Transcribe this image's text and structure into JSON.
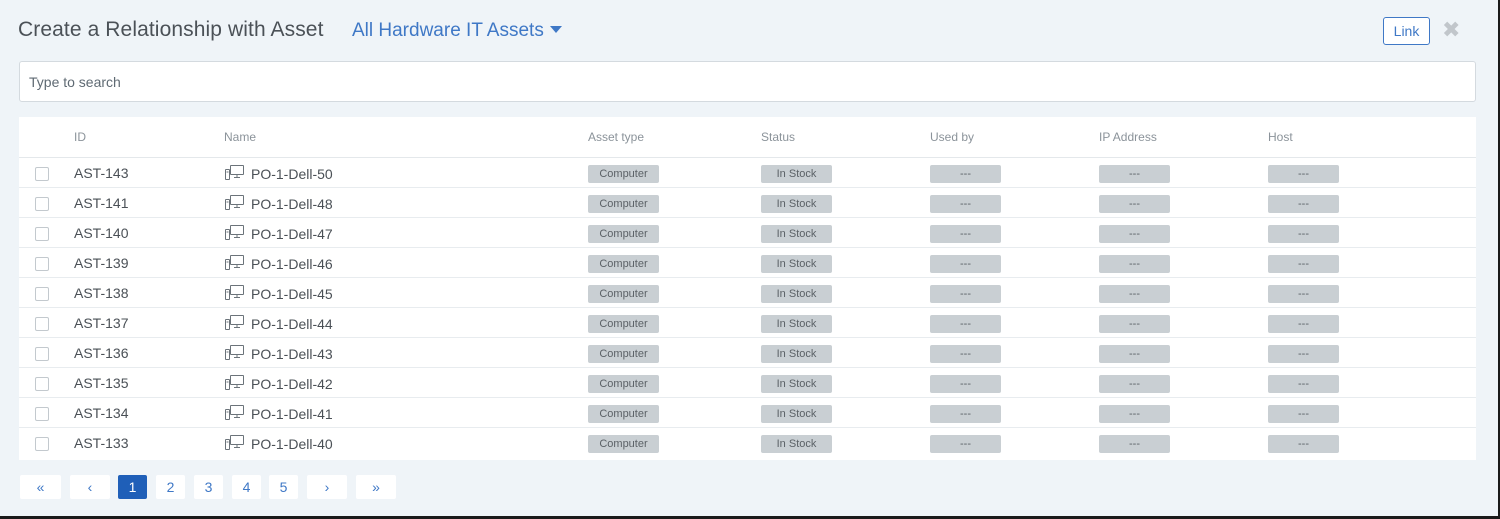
{
  "header": {
    "title": "Create a Relationship with Asset",
    "filter_label": "All Hardware IT Assets",
    "link_label": "Link",
    "close_glyph": "✖"
  },
  "search": {
    "placeholder": "Type to search"
  },
  "table": {
    "columns": [
      "ID",
      "Name",
      "Asset type",
      "Status",
      "Used by",
      "IP Address",
      "Host"
    ],
    "rows": [
      {
        "id": "AST-143",
        "name": "PO-1-Dell-50",
        "asset_type": "Computer",
        "status": "In Stock",
        "used_by": "---",
        "ip_address": "---",
        "host": "---"
      },
      {
        "id": "AST-141",
        "name": "PO-1-Dell-48",
        "asset_type": "Computer",
        "status": "In Stock",
        "used_by": "---",
        "ip_address": "---",
        "host": "---"
      },
      {
        "id": "AST-140",
        "name": "PO-1-Dell-47",
        "asset_type": "Computer",
        "status": "In Stock",
        "used_by": "---",
        "ip_address": "---",
        "host": "---"
      },
      {
        "id": "AST-139",
        "name": "PO-1-Dell-46",
        "asset_type": "Computer",
        "status": "In Stock",
        "used_by": "---",
        "ip_address": "---",
        "host": "---"
      },
      {
        "id": "AST-138",
        "name": "PO-1-Dell-45",
        "asset_type": "Computer",
        "status": "In Stock",
        "used_by": "---",
        "ip_address": "---",
        "host": "---"
      },
      {
        "id": "AST-137",
        "name": "PO-1-Dell-44",
        "asset_type": "Computer",
        "status": "In Stock",
        "used_by": "---",
        "ip_address": "---",
        "host": "---"
      },
      {
        "id": "AST-136",
        "name": "PO-1-Dell-43",
        "asset_type": "Computer",
        "status": "In Stock",
        "used_by": "---",
        "ip_address": "---",
        "host": "---"
      },
      {
        "id": "AST-135",
        "name": "PO-1-Dell-42",
        "asset_type": "Computer",
        "status": "In Stock",
        "used_by": "---",
        "ip_address": "---",
        "host": "---"
      },
      {
        "id": "AST-134",
        "name": "PO-1-Dell-41",
        "asset_type": "Computer",
        "status": "In Stock",
        "used_by": "---",
        "ip_address": "---",
        "host": "---"
      },
      {
        "id": "AST-133",
        "name": "PO-1-Dell-40",
        "asset_type": "Computer",
        "status": "In Stock",
        "used_by": "---",
        "ip_address": "---",
        "host": "---"
      }
    ],
    "row_icon": "computer-icon"
  },
  "pagination": {
    "first": "«",
    "prev": "‹",
    "pages": [
      "1",
      "2",
      "3",
      "4",
      "5"
    ],
    "current": "1",
    "next": "›",
    "last": "»"
  },
  "colors": {
    "accent": "#3f78c6",
    "active_page": "#1f5fb8",
    "badge_bg": "#c9cfd3",
    "modal_bg": "#eff4f8"
  }
}
